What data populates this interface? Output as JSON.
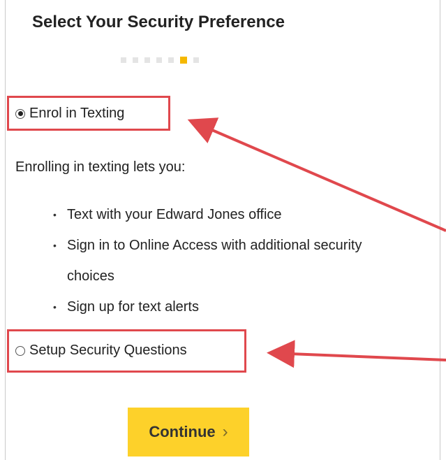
{
  "header": {
    "title": "Select Your Security Preference",
    "steps": {
      "total": 7,
      "current": 6
    }
  },
  "options": {
    "texting": {
      "label": "Enrol in Texting",
      "selected": true
    },
    "questions": {
      "label": "Setup Security Questions",
      "selected": false
    }
  },
  "texting_info": {
    "intro": "Enrolling in texting lets you:",
    "benefits": [
      "Text with your Edward Jones office",
      "Sign in to Online Access with additional security",
      "choices",
      "Sign up for text alerts"
    ]
  },
  "actions": {
    "continue_label": "Continue",
    "continue_chevron": "›"
  },
  "colors": {
    "accent": "#fdd12a",
    "step_active": "#f5b800",
    "annotation": "#e0484d"
  }
}
